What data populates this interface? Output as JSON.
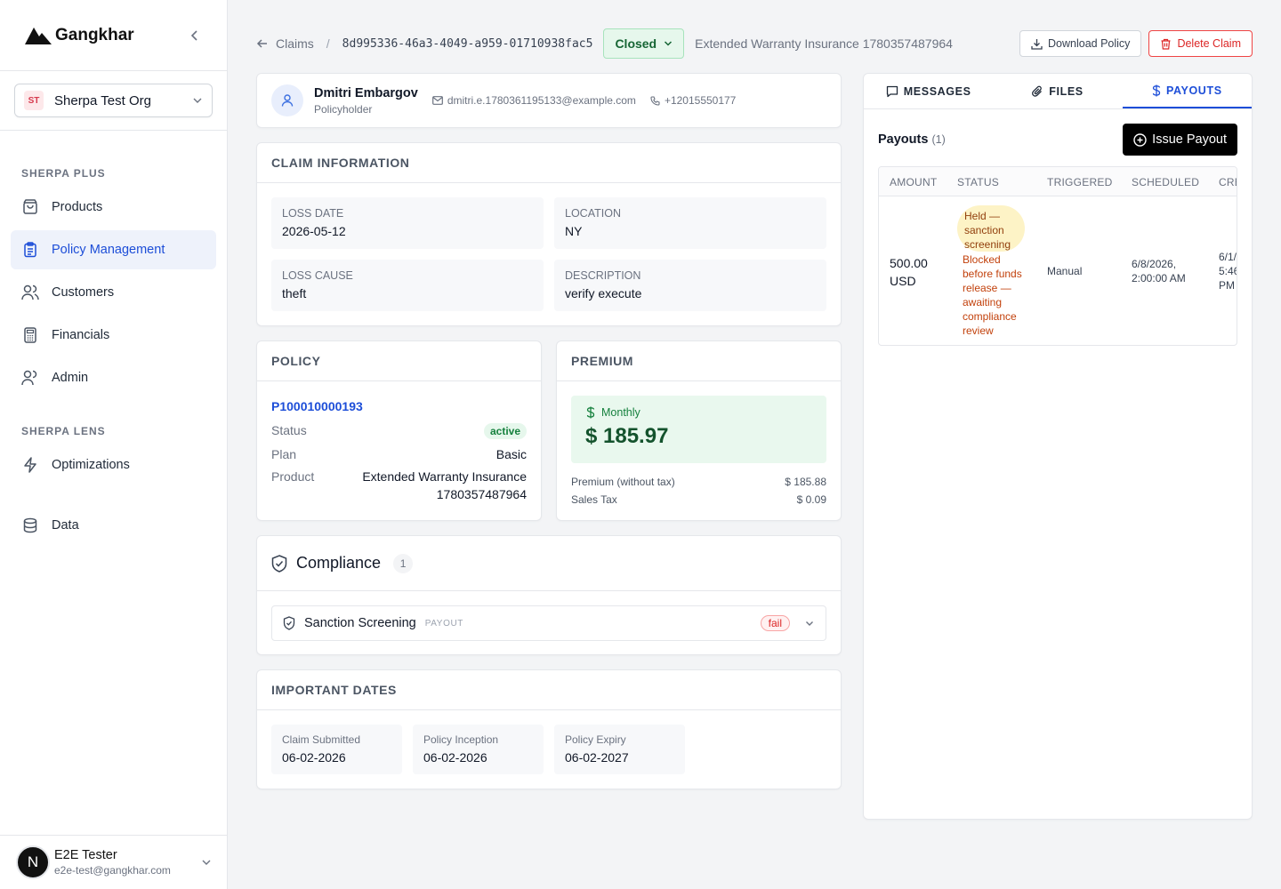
{
  "brand": {
    "name": "Gangkhar"
  },
  "org": {
    "initials": "ST",
    "name": "Sherpa Test Org"
  },
  "nav": {
    "section1": "SHERPA PLUS",
    "items1": [
      {
        "label": "Products",
        "icon": "bag-icon"
      },
      {
        "label": "Policy Management",
        "icon": "clipboard-icon",
        "active": true
      },
      {
        "label": "Customers",
        "icon": "users-icon"
      },
      {
        "label": "Financials",
        "icon": "calculator-icon"
      },
      {
        "label": "Admin",
        "icon": "user-cog-icon"
      }
    ],
    "section2": "SHERPA LENS",
    "items2": [
      {
        "label": "Optimizations",
        "icon": "bolt-icon"
      },
      {
        "label": "Data",
        "icon": "database-icon"
      }
    ]
  },
  "user": {
    "initial": "N",
    "name": "E2E Tester",
    "email": "e2e-test@gangkhar.com"
  },
  "topbar": {
    "back_label": "Claims",
    "claim_id": "8d995336-46a3-4049-a959-01710938fac5",
    "status": "Closed",
    "product": "Extended Warranty Insurance 1780357487964",
    "download": "Download Policy",
    "delete": "Delete Claim"
  },
  "holder": {
    "name": "Dmitri Embargov",
    "role": "Policyholder",
    "email": "dmitri.e.1780361195133@example.com",
    "phone": "+12015550177"
  },
  "claim_info": {
    "title": "CLAIM INFORMATION",
    "fields": [
      {
        "label": "LOSS DATE",
        "value": "2026-05-12"
      },
      {
        "label": "LOCATION",
        "value": "NY"
      },
      {
        "label": "LOSS CAUSE",
        "value": "theft"
      },
      {
        "label": "DESCRIPTION",
        "value": "verify execute"
      }
    ]
  },
  "policy": {
    "title": "POLICY",
    "number": "P100010000193",
    "status_label": "Status",
    "status": "active",
    "plan_label": "Plan",
    "plan": "Basic",
    "product_label": "Product",
    "product_line1": "Extended Warranty Insurance",
    "product_line2": "1780357487964"
  },
  "premium": {
    "title": "PREMIUM",
    "period": "Monthly",
    "amount": "$ 185.97",
    "lines": [
      {
        "label": "Premium (without tax)",
        "value": "$ 185.88"
      },
      {
        "label": "Sales Tax",
        "value": "$ 0.09"
      }
    ]
  },
  "compliance": {
    "title": "Compliance",
    "count": "1",
    "item": {
      "name": "Sanction Screening",
      "type": "PAYOUT",
      "result": "fail"
    }
  },
  "dates": {
    "title": "IMPORTANT DATES",
    "items": [
      {
        "label": "Claim Submitted",
        "value": "06-02-2026"
      },
      {
        "label": "Policy Inception",
        "value": "06-02-2026"
      },
      {
        "label": "Policy Expiry",
        "value": "06-02-2027"
      }
    ]
  },
  "tabs": [
    {
      "label": "MESSAGES",
      "icon": "message-icon"
    },
    {
      "label": "FILES",
      "icon": "paperclip-icon"
    },
    {
      "label": "PAYOUTS",
      "icon": "dollar-icon",
      "active": true
    }
  ],
  "payouts": {
    "title": "Payouts",
    "count": "(1)",
    "issue_button": "Issue Payout",
    "columns": [
      "AMOUNT",
      "STATUS",
      "TRIGGERED",
      "SCHEDULED",
      "CRE"
    ],
    "row": {
      "amount_line1": "500.00",
      "amount_line2": "USD",
      "status_line1": "Held —",
      "status_line2": "sanction",
      "status_line3": "screening",
      "reason_lines": [
        "Blocked",
        "before funds",
        "release —",
        "awaiting",
        "compliance",
        "review"
      ],
      "triggered": "Manual",
      "scheduled_line1": "6/8/2026,",
      "scheduled_line2": "2:00:00 AM",
      "created_line1": "6/1/",
      "created_line2": "5:46",
      "created_line3": "PM"
    }
  }
}
